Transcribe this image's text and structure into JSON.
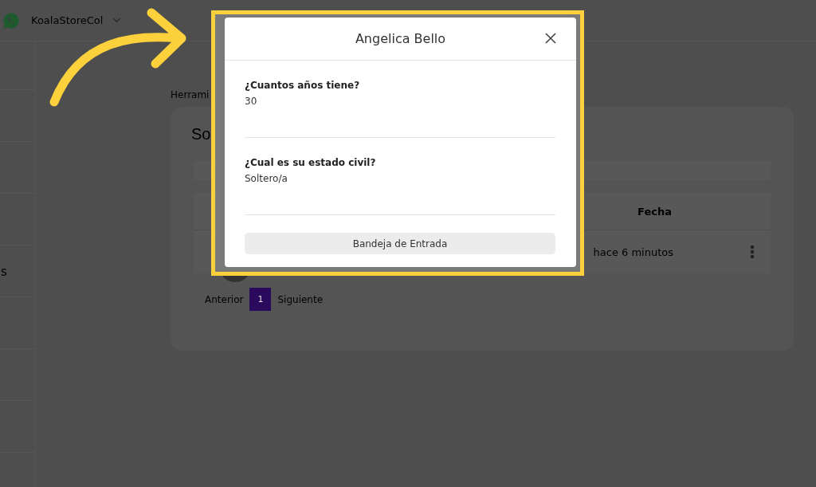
{
  "topbar": {
    "account": "KoalaStoreCol"
  },
  "sidebar": {
    "label": "s"
  },
  "breadcrumb": "Herrami",
  "card": {
    "title": "So",
    "table": {
      "columns": [
        {
          "label": "Fecha"
        }
      ],
      "rows": [
        {
          "date": "hace 6 minutos"
        }
      ]
    },
    "pagination": {
      "previous": "Anterior",
      "pages": [
        {
          "label": "1",
          "selected": true
        }
      ],
      "next": "Siguiente"
    }
  },
  "modal": {
    "title": "Angelica Bello",
    "answers": [
      {
        "question": "¿Cuantos años tiene?",
        "answer": "30"
      },
      {
        "question": "¿Cual es su estado civil?",
        "answer": "Soltero/a"
      }
    ],
    "button": "Bandeja de Entrada"
  }
}
